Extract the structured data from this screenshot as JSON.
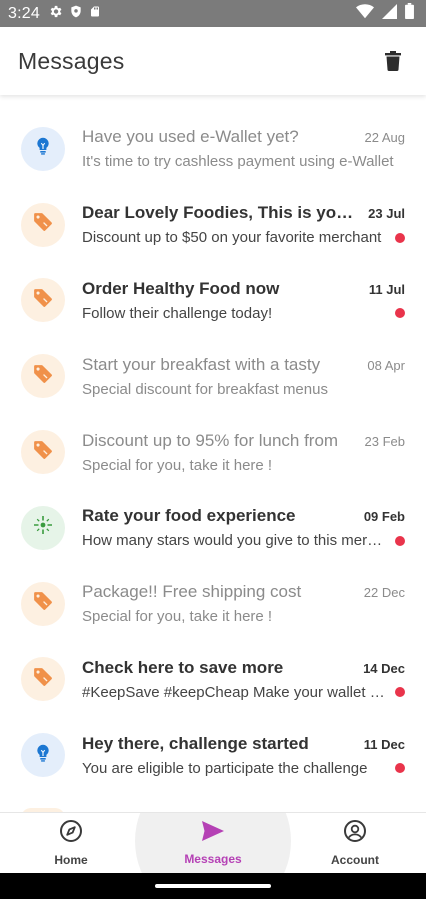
{
  "status_bar": {
    "time": "3:24"
  },
  "header": {
    "title": "Messages"
  },
  "messages": [
    {
      "icon": "lightbulb-icon",
      "color": "blue",
      "title": "Have you used e-Wallet yet?",
      "date": "22 Aug",
      "desc": "It's time to try cashless payment using e-Wallet",
      "unread": false
    },
    {
      "icon": "tag-icon",
      "color": "orange",
      "title": "Dear Lovely Foodies, This is your chance",
      "date": "23 Jul",
      "desc": "Discount up to $50 on your favorite merchant",
      "unread": true
    },
    {
      "icon": "tag-icon",
      "color": "orange",
      "title": "Order Healthy Food now",
      "date": "11 Jul",
      "desc": "Follow their challenge today!",
      "unread": true
    },
    {
      "icon": "tag-icon",
      "color": "orange",
      "title": "Start your breakfast with a tasty",
      "date": "08 Apr",
      "desc": "Special discount for breakfast menus",
      "unread": false
    },
    {
      "icon": "tag-icon",
      "color": "orange",
      "title": "Discount up to 95% for lunch from",
      "date": "23 Feb",
      "desc": "Special for you, take it here !",
      "unread": false
    },
    {
      "icon": "sparkle-icon",
      "color": "green",
      "title": "Rate your food experience",
      "date": "09 Feb",
      "desc": "How many stars would you give to this merchant?",
      "unread": true
    },
    {
      "icon": "tag-icon",
      "color": "orange",
      "title": "Package!! Free shipping cost",
      "date": "22 Dec",
      "desc": "Special for you, take it here !",
      "unread": false
    },
    {
      "icon": "tag-icon",
      "color": "orange",
      "title": "Check here to save more",
      "date": "14 Dec",
      "desc": "#KeepSave #keepCheap Make your wallet happy",
      "unread": true
    },
    {
      "icon": "lightbulb-icon",
      "color": "blue",
      "title": "Hey there, challenge started",
      "date": "11 Dec",
      "desc": "You are eligible to participate the challenge",
      "unread": true
    }
  ],
  "bottom_nav": [
    {
      "label": "Home",
      "icon": "compass-icon",
      "active": false
    },
    {
      "label": "Messages",
      "icon": "send-icon",
      "active": true
    },
    {
      "label": "Account",
      "icon": "account-icon",
      "active": false
    }
  ],
  "colors": {
    "accent": "#b541b5",
    "unread_dot": "#e9344b",
    "tag_icon": "#f0914a",
    "bulb_icon": "#1c77d2",
    "sparkle_icon": "#3a9b3f"
  }
}
